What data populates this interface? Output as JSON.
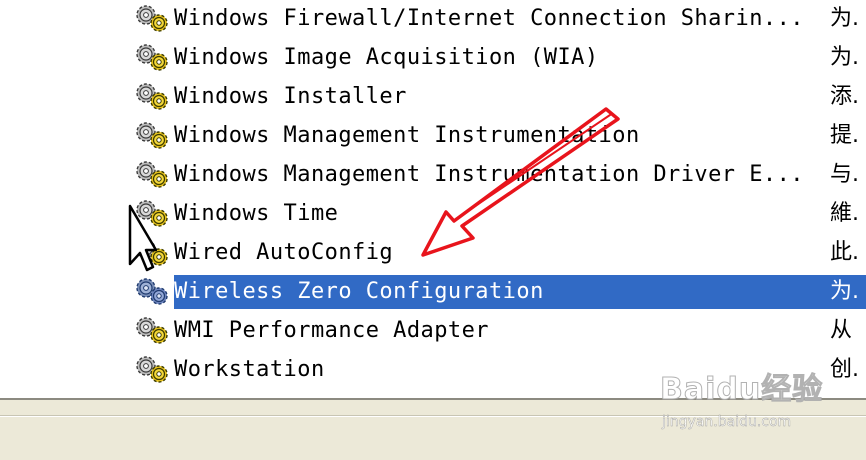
{
  "services": [
    {
      "name": "Windows Firewall/Internet Connection Sharin...",
      "desc": "为.",
      "icon": "services-gear-icon",
      "selected": false
    },
    {
      "name": "Windows Image Acquisition (WIA)",
      "desc": "为.",
      "icon": "services-gear-icon",
      "selected": false
    },
    {
      "name": "Windows Installer",
      "desc": "添.",
      "icon": "services-gear-icon",
      "selected": false
    },
    {
      "name": "Windows Management Instrumentation",
      "desc": "提.",
      "icon": "services-gear-icon",
      "selected": false
    },
    {
      "name": "Windows Management Instrumentation Driver E...",
      "desc": "与.",
      "icon": "services-gear-icon",
      "selected": false
    },
    {
      "name": "Windows Time",
      "desc": "維.",
      "icon": "services-gear-icon",
      "selected": false
    },
    {
      "name": "Wired AutoConfig",
      "desc": "此.",
      "icon": "services-gear-icon",
      "selected": false
    },
    {
      "name": "Wireless Zero Configuration",
      "desc": "为.",
      "icon": "services-gear-icon",
      "selected": true
    },
    {
      "name": "WMI Performance Adapter",
      "desc": "从",
      "icon": "services-gear-icon",
      "selected": false
    },
    {
      "name": "Workstation",
      "desc": "创.",
      "icon": "services-gear-icon",
      "selected": false
    }
  ],
  "colors": {
    "selection": "#316ac5",
    "statusbar": "#ece9d8",
    "arrow": "#e8141c"
  },
  "watermark": {
    "brand": "Baidu经验",
    "url": "jingyan.baidu.com"
  }
}
